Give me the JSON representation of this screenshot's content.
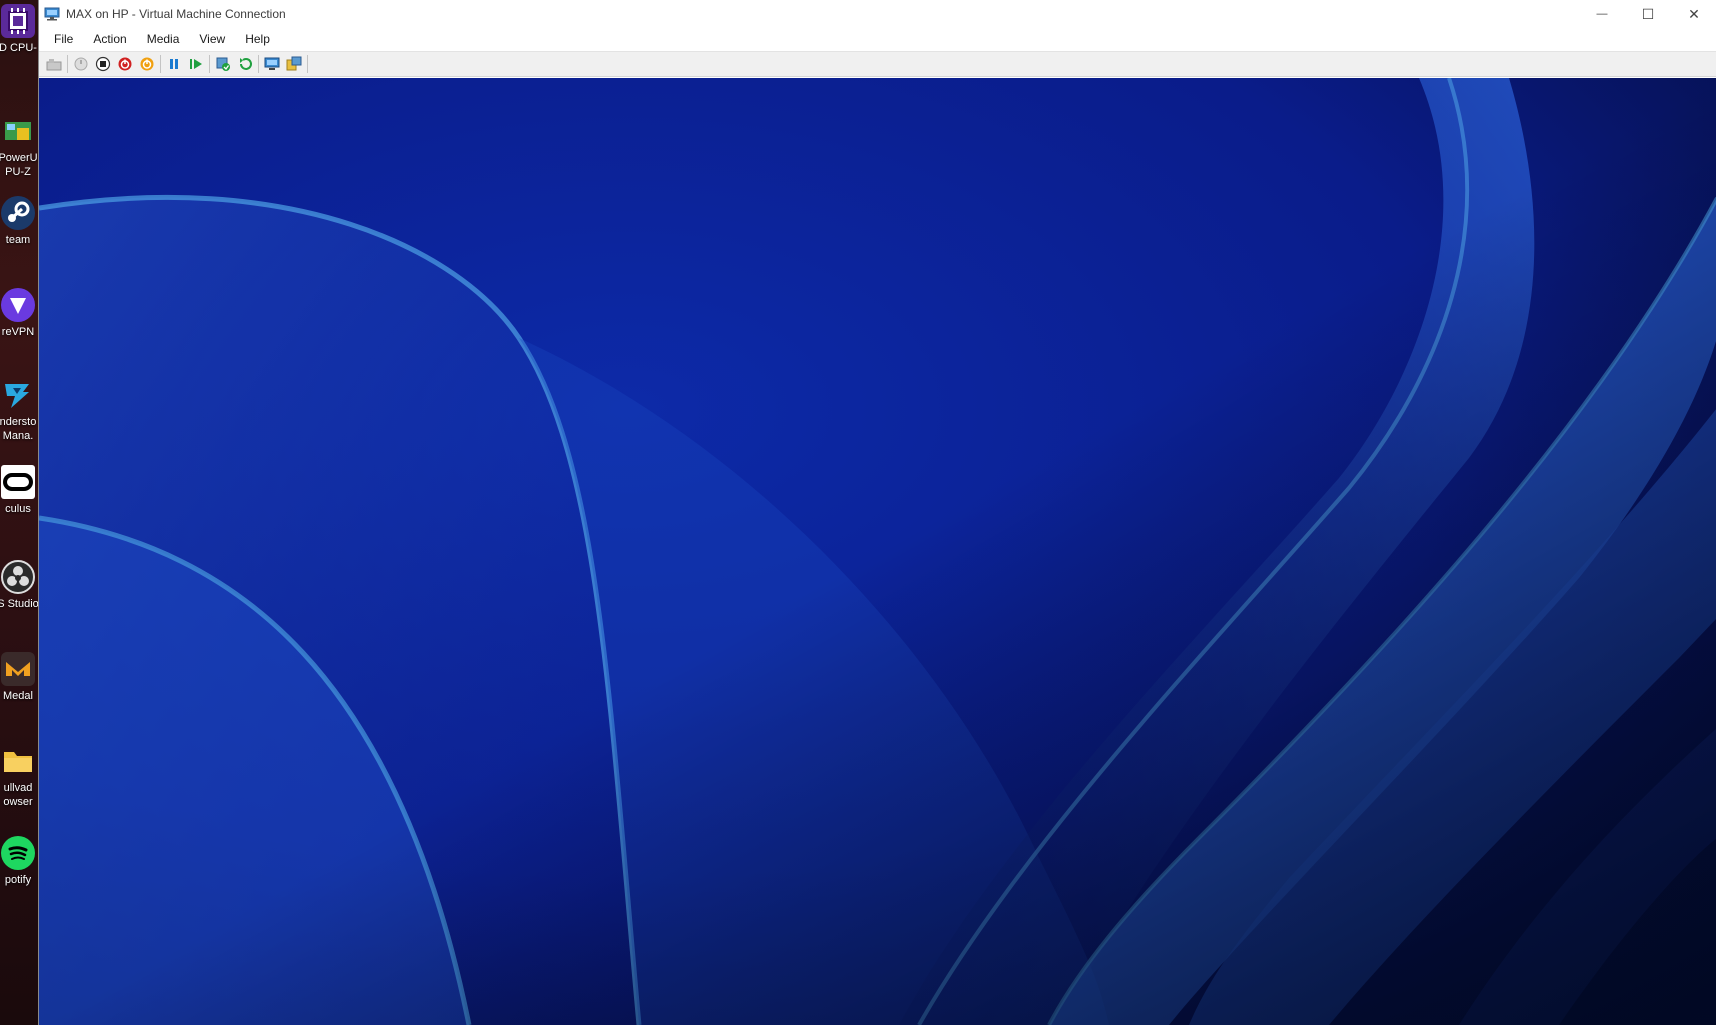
{
  "window": {
    "title": "MAX on HP - Virtual Machine Connection",
    "minimize_glyph": "—",
    "maximize_glyph": "☐",
    "close_glyph": "✕"
  },
  "menu": {
    "items": [
      "File",
      "Action",
      "Media",
      "View",
      "Help"
    ]
  },
  "toolbar": {
    "buttons": [
      {
        "name": "ctrl-alt-del-icon"
      },
      {
        "name": "start-icon"
      },
      {
        "name": "turn-off-icon"
      },
      {
        "name": "shut-down-icon"
      },
      {
        "name": "save-state-icon"
      },
      {
        "name": "pause-icon"
      },
      {
        "name": "resume-icon"
      },
      {
        "name": "checkpoint-icon"
      },
      {
        "name": "revert-icon"
      },
      {
        "name": "enhanced-session-icon"
      },
      {
        "name": "share-icon"
      }
    ]
  },
  "desktop": {
    "icons": [
      {
        "name": "cpu-id-icon",
        "label": "D CPU-",
        "label2": ""
      },
      {
        "name": "gpu-z-icon",
        "label": "PowerU",
        "label2": "PU-Z"
      },
      {
        "name": "steam-icon",
        "label": "team",
        "label2": ""
      },
      {
        "name": "protonvpn-icon",
        "label": "reVPN",
        "label2": ""
      },
      {
        "name": "thunderstore-icon",
        "label": "ndersto",
        "label2": "Mana."
      },
      {
        "name": "oculus-icon",
        "label": "culus",
        "label2": ""
      },
      {
        "name": "obs-studio-icon",
        "label": "S Studio",
        "label2": ""
      },
      {
        "name": "medal-icon",
        "label": "Medal",
        "label2": ""
      },
      {
        "name": "mullvad-browser-icon",
        "label": "ullvad",
        "label2": "owser"
      },
      {
        "name": "spotify-icon",
        "label": "potify",
        "label2": ""
      }
    ]
  },
  "colors": {
    "wallpaper_base": "#0b1e8a",
    "wallpaper_ribbon": "#2f6fcf",
    "titlebar_bg": "#ffffff",
    "toolbar_bg": "#f0f0f0"
  }
}
